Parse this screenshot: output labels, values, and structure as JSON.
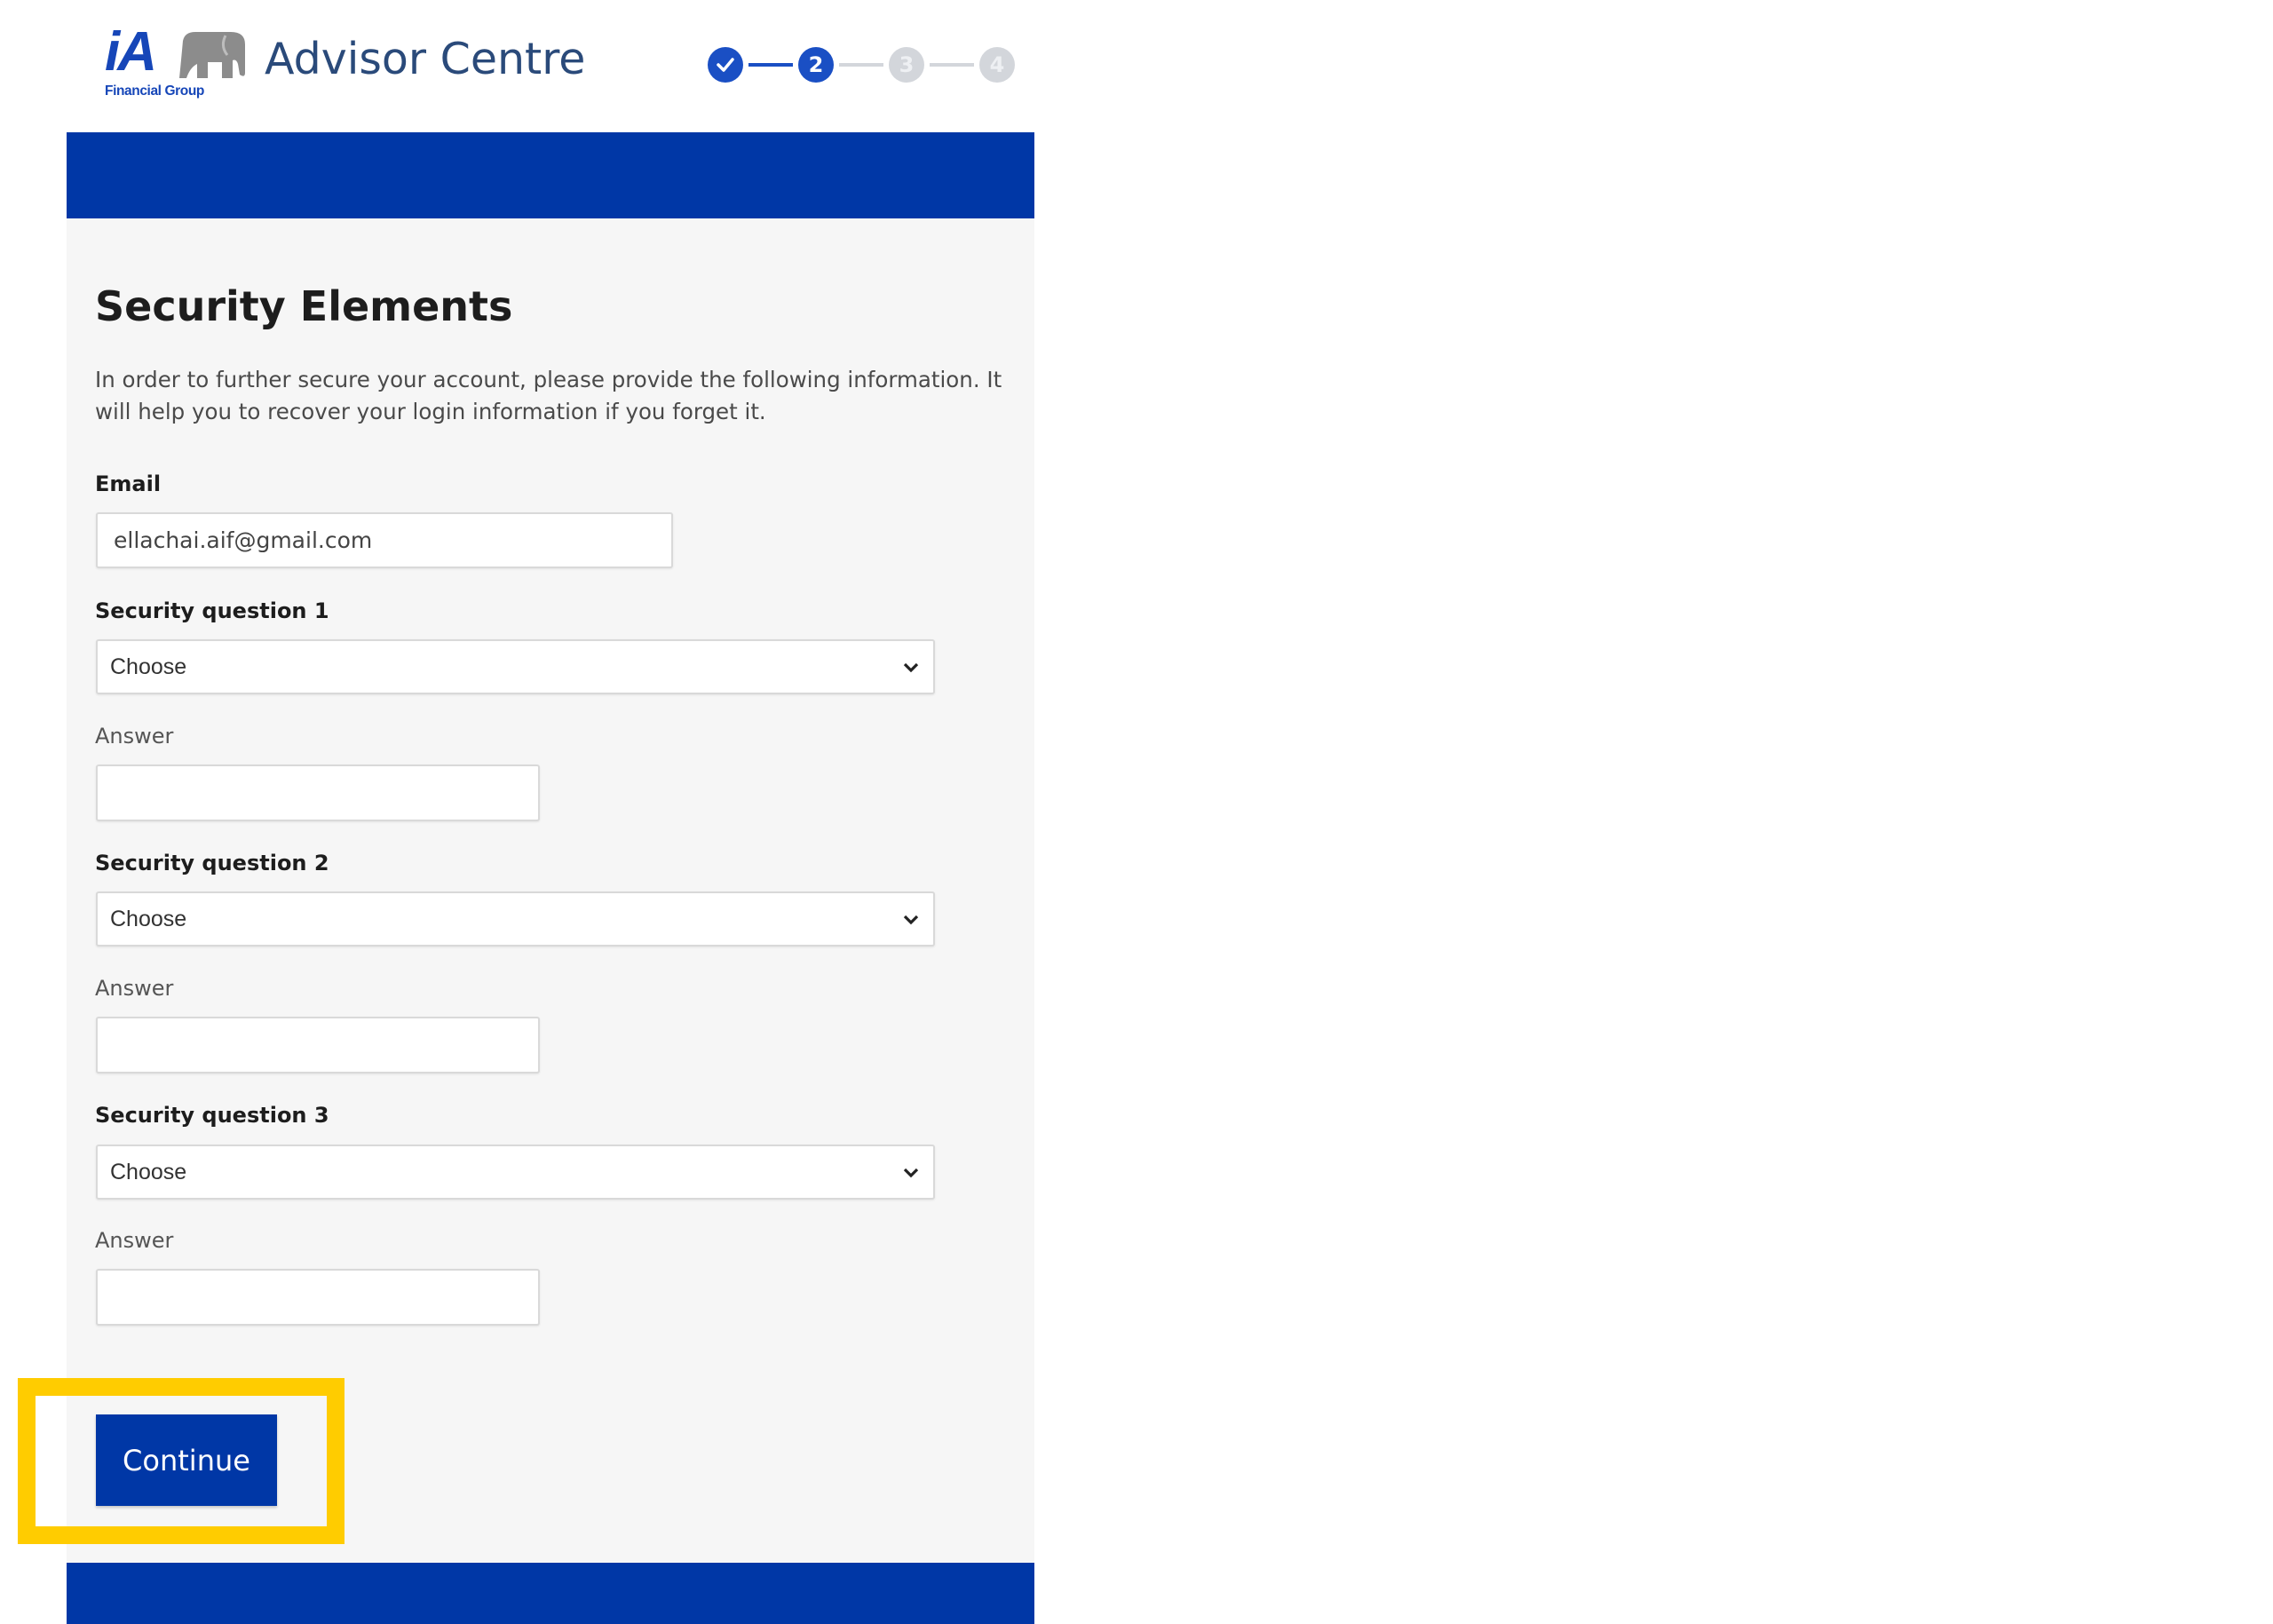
{
  "header": {
    "logo_text": "iA",
    "logo_subtext": "Financial Group",
    "app_title": "Advisor Centre",
    "stepper": [
      {
        "label": "1",
        "state": "done",
        "icon": "check-icon"
      },
      {
        "label": "2",
        "state": "active"
      },
      {
        "label": "3",
        "state": "todo"
      },
      {
        "label": "4",
        "state": "todo"
      }
    ]
  },
  "form": {
    "title": "Security Elements",
    "intro": "In order to further secure your account, please provide the following information. It will help you to recover your login information if you forget it.",
    "email": {
      "label": "Email",
      "value": "ellachai.aif@gmail.com"
    },
    "questions": [
      {
        "label": "Security question 1",
        "selected": "Choose",
        "answer_label": "Answer",
        "answer_value": ""
      },
      {
        "label": "Security question 2",
        "selected": "Choose",
        "answer_label": "Answer",
        "answer_value": ""
      },
      {
        "label": "Security question 3",
        "selected": "Choose",
        "answer_label": "Answer",
        "answer_value": ""
      }
    ],
    "continue_label": "Continue"
  },
  "colors": {
    "brand_blue": "#0037a6",
    "step_blue": "#1a4fc4",
    "highlight": "#ffcc00",
    "panel_bg": "#f6f6f6"
  }
}
